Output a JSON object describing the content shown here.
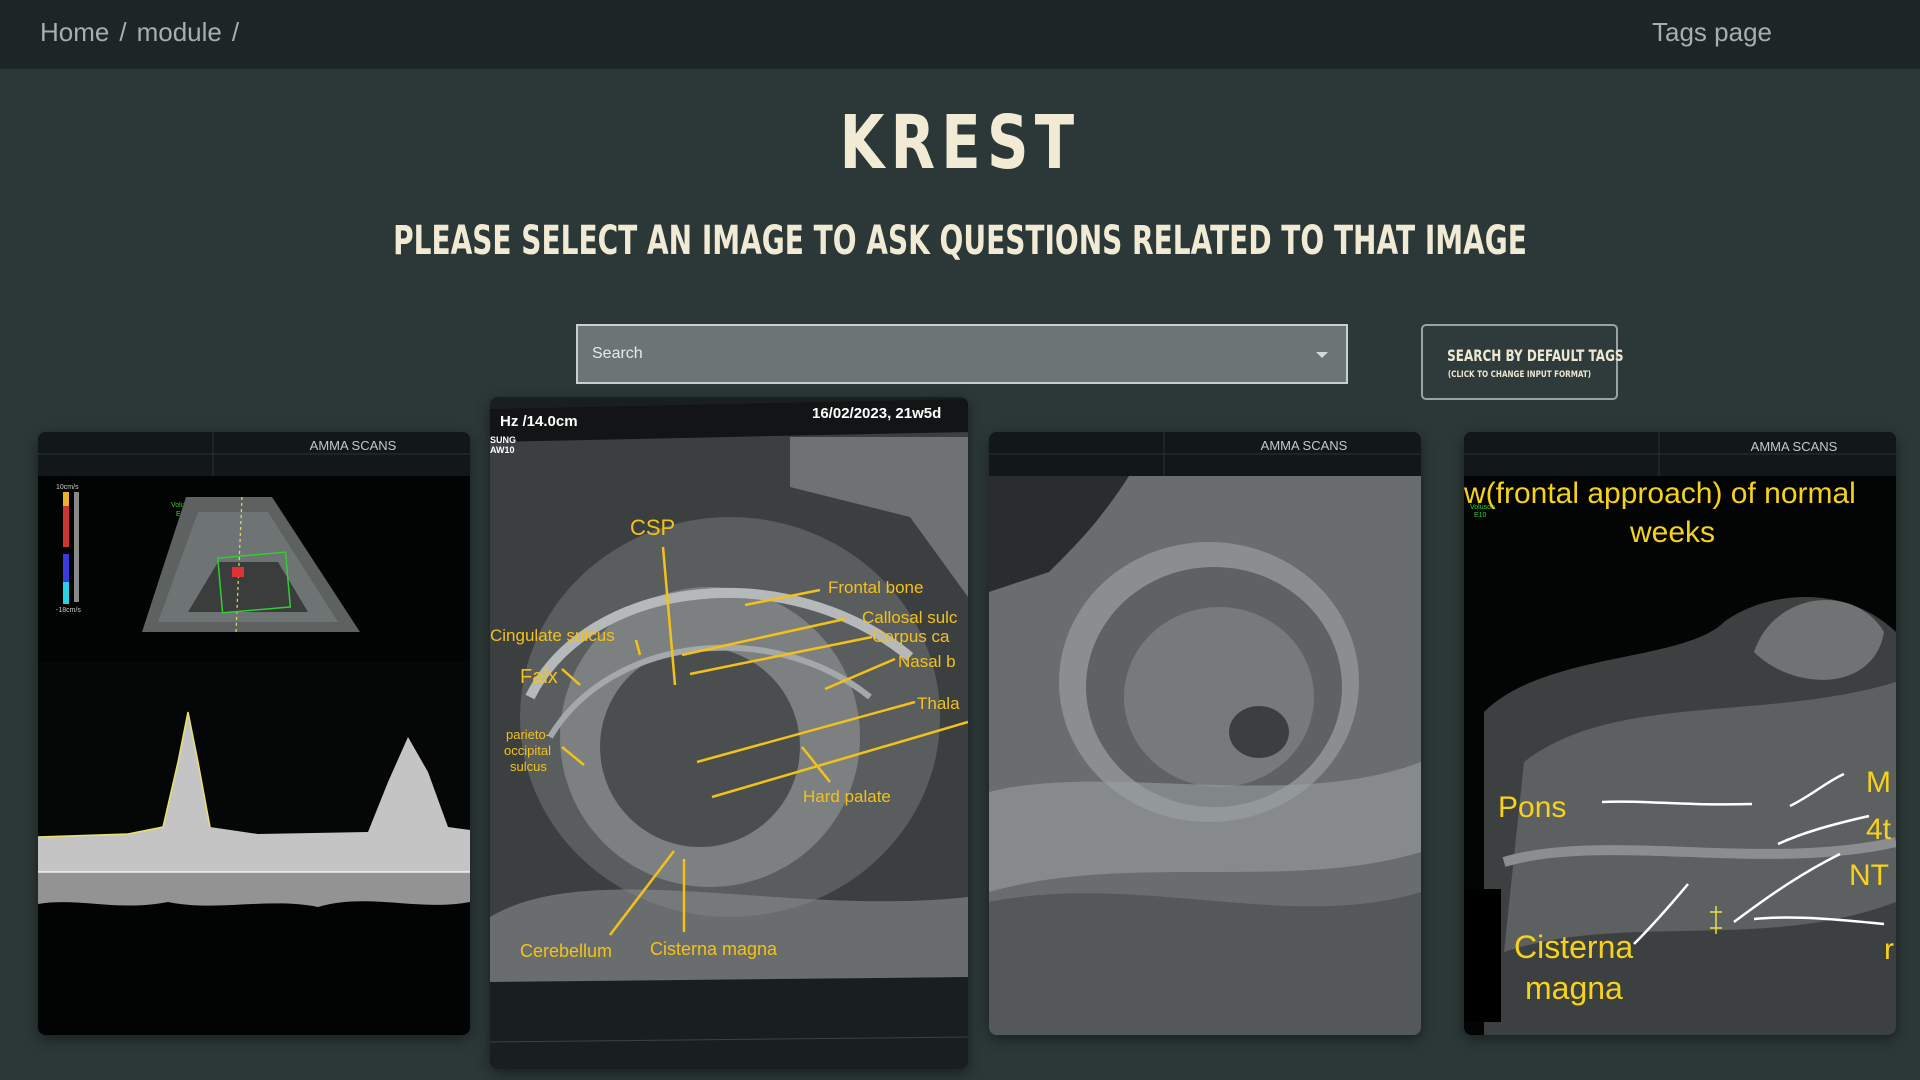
{
  "breadcrumb": {
    "home": "Home",
    "sep1": "/",
    "module": "module",
    "sep2": "/"
  },
  "nav": {
    "tags_page": "Tags page"
  },
  "page": {
    "title": "KREST",
    "subtitle": "PLEASE SELECT AN IMAGE TO ASK QUESTIONS RELATED TO THAT IMAGE"
  },
  "search": {
    "placeholder": "Search"
  },
  "tags_button": {
    "label": "SEARCH BY DEFAULT TAGS",
    "sublabel": "(CLICK TO CHANGE INPUT FORMAT)"
  },
  "images": [
    {
      "header": "AMMA SCANS",
      "scale_top": "10cm/s",
      "scale_bottom": "-18cm/s",
      "brand": "Voluson",
      "brand_sub": "E10"
    },
    {
      "header_left": "Hz /14.0cm",
      "header_right": "16/02/2023, 21w5d",
      "device": "SUNG",
      "device_sub": "AW10",
      "labels": {
        "csp": "CSP",
        "frontal_bone": "Frontal bone",
        "callosal_sulcus": "Callosal sulc",
        "corpus_callosum": "Corpus ca",
        "cingulate_sulcus": "Cingulate sulcus",
        "nasal_bone": "Nasal b",
        "falx": "Falx",
        "thalamus": "Thala",
        "parieto_1": "parieto-",
        "parieto_2": "occipital",
        "parieto_3": "sulcus",
        "hard_palate": "Hard palate",
        "cerebellum": "Cerebellum",
        "cisterna_magna": "Cisterna magna"
      }
    },
    {
      "header": "AMMA SCANS"
    },
    {
      "header": "AMMA SCANS",
      "caption_1": "w(frontal approach) of normal",
      "caption_2": "weeks",
      "brand": "Voluson",
      "brand_sub": "E10",
      "labels": {
        "pons": "Pons",
        "m": "M",
        "fourth": "4t",
        "nt": "NT",
        "r": "r",
        "cisterna": "Cisterna",
        "magna": "magna"
      }
    }
  ]
}
